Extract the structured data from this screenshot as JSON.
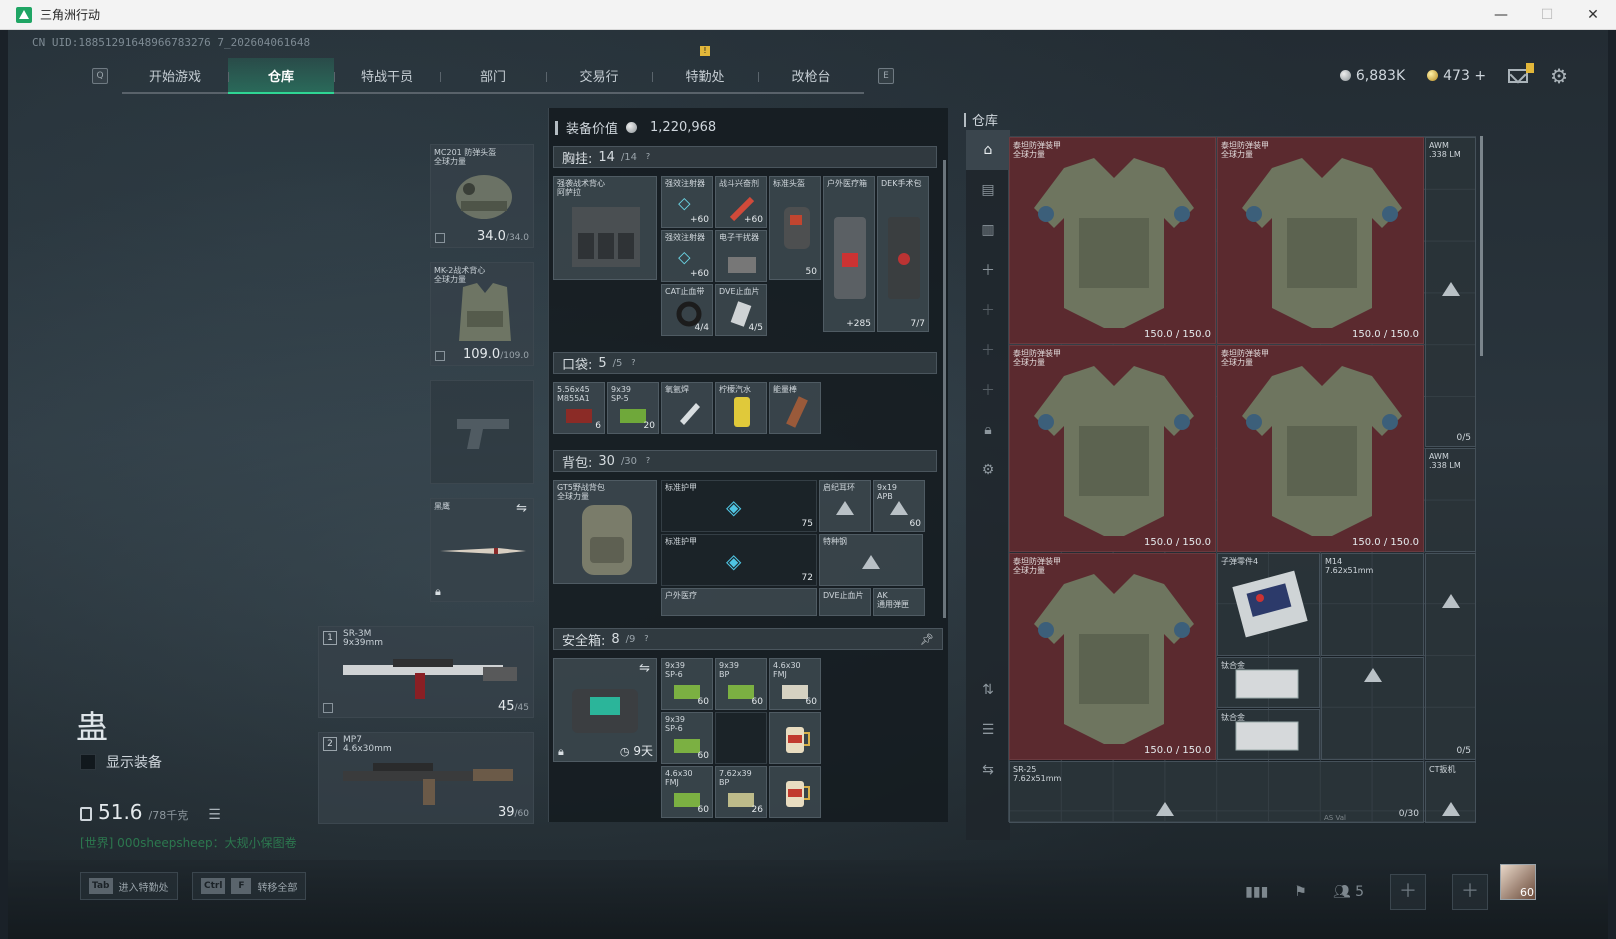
{
  "window": {
    "title": "三角洲行动",
    "min": "—",
    "max": "☐",
    "close": "✕"
  },
  "uid": "CN UID:18851291648966783276 7_202604061648",
  "tabs": {
    "key_left": "Q",
    "key_right": "E",
    "items": [
      "开始游戏",
      "仓库",
      "特战干员",
      "部门",
      "交易行",
      "特勤处",
      "改枪台"
    ],
    "active_index": 1,
    "warn_badge": "!"
  },
  "currency": {
    "silver": "6,883K",
    "gold": "473",
    "gold_plus": "+"
  },
  "character": {
    "name": "蛊",
    "show_equipment": "显示装备",
    "weight": "51.6",
    "weight_max": "/78千克"
  },
  "world_chat": "[世界] 000sheepsheep：大规小保图卷",
  "slots": {
    "helmet": {
      "label": "MC201 防弹头盔\n全球力量",
      "dur": "34.0",
      "max": "/34.0"
    },
    "armor": {
      "label": "MK-2战术背心\n全球力量",
      "dur": "109.0",
      "max": "/109.0"
    },
    "melee": {
      "label": "黑鹰"
    },
    "weapon1": {
      "num": "1",
      "name": "SR-3M",
      "sub": "9x39mm",
      "ammo": "45",
      "max": "/45"
    },
    "weapon2": {
      "num": "2",
      "name": "MP7",
      "sub": "4.6x30mm",
      "ammo": "39",
      "max": "/60"
    }
  },
  "middle": {
    "equip_value_label": "装备价值",
    "equip_value": "1,220,968",
    "chest": {
      "label": "胸挂:",
      "val": "14",
      "max": "/14",
      "rig": "强袭战术背心\n阿萨拉"
    },
    "chest_items": [
      {
        "label": "强效注射器",
        "cnt": "+60"
      },
      {
        "label": "战斗兴奋剂",
        "cnt": "+60"
      },
      {
        "label": "标准头盔",
        "cnt": "50"
      },
      {
        "label": "户外医疗箱",
        "cnt": "+285"
      },
      {
        "label": "DEK手术包",
        "cnt": "7/7"
      },
      {
        "label": "强效注射器",
        "cnt": "+60"
      },
      {
        "label": "电子干扰器",
        "cnt": ""
      },
      {
        "label": "CAT止血带",
        "cnt": "4/4"
      },
      {
        "label": "DVE止血片",
        "cnt": "4/5"
      }
    ],
    "pocket": {
      "label": "口袋:",
      "val": "5",
      "max": "/5"
    },
    "pocket_items": [
      {
        "label": "5.56x45\nM855A1",
        "cnt": "6"
      },
      {
        "label": "9x39\nSP-5",
        "cnt": "20"
      },
      {
        "label": "氧氩焊",
        "cnt": ""
      },
      {
        "label": "柠檬汽水",
        "cnt": ""
      },
      {
        "label": "能量棒",
        "cnt": ""
      }
    ],
    "backpack": {
      "label": "背包:",
      "val": "30",
      "max": "/30",
      "bag": "GT5野战背包\n全球力量"
    },
    "backpack_items": [
      {
        "label": "标准护甲",
        "cnt": "75"
      },
      {
        "label": "启纪耳环",
        "cnt": ""
      },
      {
        "label": "9x19\nAPB",
        "cnt": "60"
      },
      {
        "label": "标准护甲",
        "cnt": "72"
      },
      {
        "label": "特种钢",
        "cnt": ""
      },
      {
        "label": "户外医疗",
        "cnt": ""
      },
      {
        "label": "DVE止血片",
        "cnt": ""
      },
      {
        "label": "AK\n通用弹匣",
        "cnt": ""
      }
    ],
    "safe": {
      "label": "安全箱:",
      "val": "8",
      "max": "/9",
      "timer": "9天"
    },
    "safe_items": [
      {
        "label": "9x39\nSP-6",
        "cnt": "60"
      },
      {
        "label": "9x39\nBP",
        "cnt": "60"
      },
      {
        "label": "4.6x30\nFMJ",
        "cnt": "60"
      },
      {
        "label": "9x39\nSP-6",
        "cnt": "60"
      },
      {
        "label": "",
        "cnt": ""
      },
      {
        "label": "4.6x30\nFMJ",
        "cnt": "60"
      },
      {
        "label": "7.62x39\nBP",
        "cnt": "26"
      },
      {
        "label": "",
        "cnt": ""
      }
    ]
  },
  "warehouse": {
    "title": "仓库",
    "armors": [
      {
        "label": "泰坦防弹装甲\n全球力量",
        "dur": "150.0 / 150.0"
      },
      {
        "label": "泰坦防弹装甲\n全球力量",
        "dur": "150.0 / 150.0"
      },
      {
        "label": "泰坦防弹装甲\n全球力量",
        "dur": "150.0 / 150.0"
      },
      {
        "label": "泰坦防弹装甲\n全球力量",
        "dur": "150.0 / 150.0"
      },
      {
        "label": "泰坦防弹装甲\n全球力量",
        "dur": "150.0 / 150.0"
      }
    ],
    "items": [
      {
        "label": "AWM\n.338 LM",
        "cnt": "0/5"
      },
      {
        "label": "AWM\n.338 LM",
        "cnt": ""
      },
      {
        "label": "子弹零件4",
        "cnt": ""
      },
      {
        "label": "M14\n7.62x51mm",
        "cnt": ""
      },
      {
        "label": "钛合金",
        "cnt": ""
      },
      {
        "label": "钛合金",
        "cnt": ""
      },
      {
        "label": "",
        "cnt": "0/5"
      },
      {
        "label": "SR-25\n7.62x51mm",
        "cnt": "0/30"
      },
      {
        "label": "CT扳机",
        "cnt": ""
      },
      {
        "label": "AS Val",
        "cnt": ""
      }
    ]
  },
  "bottom": {
    "btn1_key": "Tab",
    "btn1_label": "进入特勤处",
    "btn2_key1": "Ctrl",
    "btn2_key2": "F",
    "btn2_label": "转移全部",
    "team_count": "5",
    "level": "60"
  },
  "colors": {
    "accent": "#2fd694",
    "armor_bg": "#5b2a2f",
    "warn": "#e2b73a"
  }
}
